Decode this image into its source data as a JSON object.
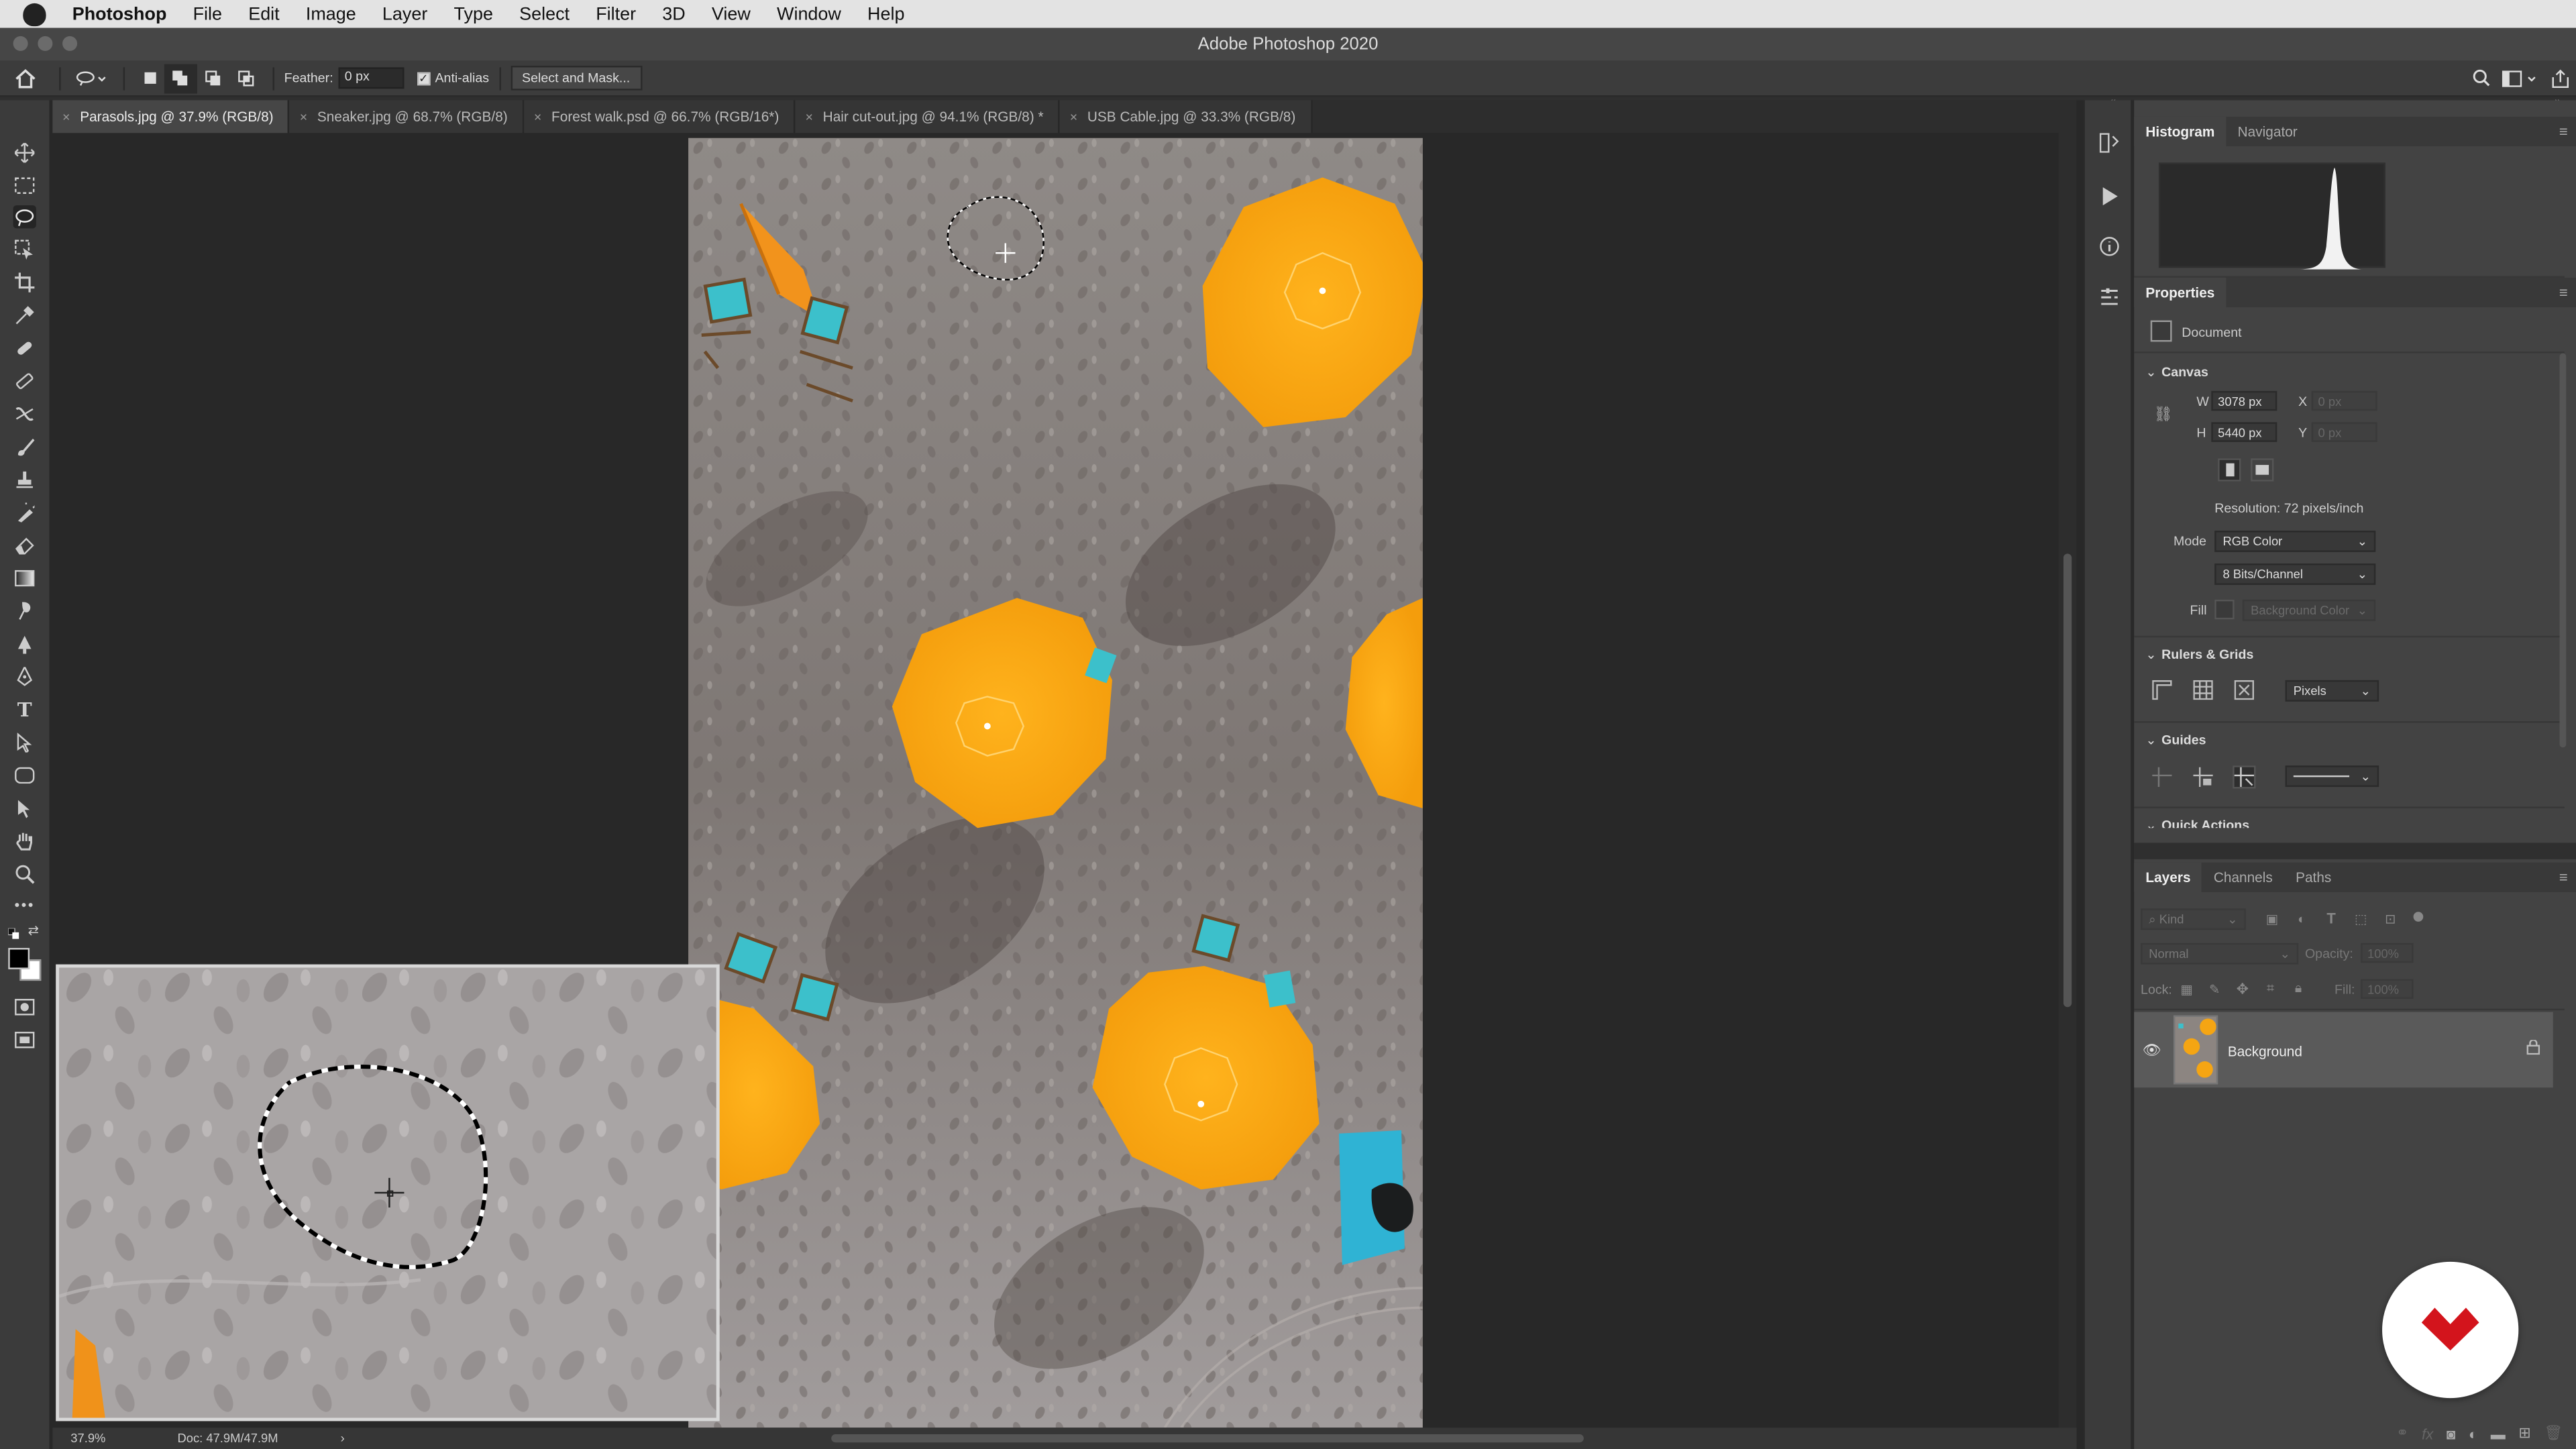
{
  "menubar": {
    "app": "Photoshop",
    "items": [
      "File",
      "Edit",
      "Image",
      "Layer",
      "Type",
      "Select",
      "Filter",
      "3D",
      "View",
      "Window",
      "Help"
    ]
  },
  "window": {
    "title": "Adobe Photoshop 2020"
  },
  "options_bar": {
    "feather_label": "Feather:",
    "feather_value": "0 px",
    "antialias_label": "Anti-alias",
    "antialias_checked": true,
    "select_mask_label": "Select and Mask..."
  },
  "tabs": [
    {
      "label": "Parasols.jpg @ 37.9% (RGB/8)",
      "active": true
    },
    {
      "label": "Sneaker.jpg @ 68.7% (RGB/8)",
      "active": false
    },
    {
      "label": "Forest walk.psd @ 66.7% (RGB/16*)",
      "active": false
    },
    {
      "label": "Hair cut-out.jpg @ 94.1% (RGB/8) *",
      "active": false
    },
    {
      "label": "USB Cable.jpg @ 33.3% (RGB/8)",
      "active": false
    }
  ],
  "status": {
    "zoom": "37.9%",
    "doc": "Doc: 47.9M/47.9M",
    "arrow": "›"
  },
  "panels": {
    "top_tabs": [
      "Histogram",
      "Navigator"
    ],
    "properties": {
      "title": "Properties",
      "document_label": "Document",
      "canvas": {
        "title": "Canvas",
        "w_label": "W",
        "w_value": "3078 px",
        "h_label": "H",
        "h_value": "5440 px",
        "x_label": "X",
        "x_value": "0 px",
        "y_label": "Y",
        "y_value": "0 px",
        "resolution": "Resolution: 72 pixels/inch",
        "mode_label": "Mode",
        "mode_value": "RGB Color",
        "bits_value": "8 Bits/Channel",
        "fill_label": "Fill",
        "fill_value": "Background Color"
      },
      "rulers": {
        "title": "Rulers & Grids",
        "unit": "Pixels"
      },
      "guides": {
        "title": "Guides"
      },
      "quick_actions": {
        "title": "Quick Actions"
      }
    },
    "layers": {
      "tabs": [
        "Layers",
        "Channels",
        "Paths"
      ],
      "kind_label": "Kind",
      "blend_mode": "Normal",
      "opacity_label": "Opacity:",
      "opacity_value": "100%",
      "lock_label": "Lock:",
      "fill_label": "Fill:",
      "fill_value": "100%",
      "layer_name": "Background"
    }
  },
  "colors": {
    "accent_orange": "#f5a513",
    "chair_cyan": "#33b7c4",
    "brand_red": "#d3141c"
  }
}
